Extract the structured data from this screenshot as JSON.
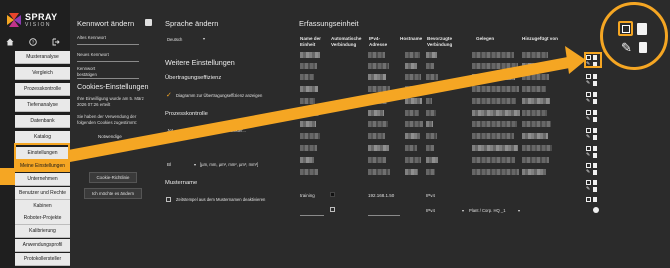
{
  "brand": {
    "name": "SPRAY",
    "sub": "VISION"
  },
  "sidebar": {
    "top_icons": [
      "home-icon",
      "help-icon",
      "logout-icon"
    ],
    "items": [
      {
        "label": "Musteranalyse"
      },
      {
        "label": "Vergleich"
      },
      {
        "label": "Prozesskontrolle"
      },
      {
        "label": "Tiefenanalyse"
      },
      {
        "label": "Datenbank"
      },
      {
        "label": "Katalog"
      },
      {
        "label": "Einstellungen"
      },
      {
        "label": "Meine Einstellungen"
      },
      {
        "label": "Unternehmen"
      },
      {
        "label": "Benutzer und Rechte"
      },
      {
        "label": "Kabinen"
      },
      {
        "label": "Roboter-Projekte"
      },
      {
        "label": "Kalibrierung"
      },
      {
        "label": "Anwendungsprofil"
      },
      {
        "label": "Protokollersteller"
      }
    ],
    "active_index": 7
  },
  "password": {
    "title": "Kennwort ändern",
    "old_label": "Altes Kennwort",
    "new_label": "Neues Kennwort",
    "confirm_label": "Kennwort bestätigen"
  },
  "cookies": {
    "title": "Cookies-Einstellungen",
    "consent_text": "Ihre Einwilligung wurde am 5. März 2026 07:26 erteilt",
    "accepted_text": "Sie haben der Verwendung der folgenden Cookies zugestimmt:",
    "items": [
      "Notwendige",
      "Analysen"
    ],
    "policy_button": "Cookie-Richtlinie",
    "change_button": "Ich möchte es ändern"
  },
  "language": {
    "title": "Sprache ändern",
    "value": "Deutsch"
  },
  "more_settings": {
    "title": "Weitere Einstellungen",
    "transfer_title": "Übertragungseffizienz",
    "transfer_option": "Diagramm zur Übertragungseffizienz anzeigen",
    "process_title": "Prozesskontrolle",
    "rows": [
      {
        "label": "Jet",
        "value": "Standardtyp für Muster..."
      },
      {
        "label": "",
        "value": ""
      },
      {
        "label": "Bl",
        "value": "[µm, mm, µm², mm², µm³, mm³]"
      }
    ],
    "pattern_title": "Mustername",
    "pattern_option": "Zeitstempel aus dem Musternamen deaktivieren"
  },
  "capture": {
    "title": "Erfassungseinheit",
    "columns": [
      "Name der Einheit",
      "Automatische Verbindung",
      "IPv4-Adresse",
      "Hostname",
      "Bevorzugte Verbindung",
      "Gelegen",
      "Hinzugefügt von"
    ],
    "rows": [
      {
        "name": "",
        "ip": "",
        "pref": ""
      },
      {
        "name": "",
        "ip": "",
        "pref": ""
      },
      {
        "name": "",
        "ip": "",
        "pref": ""
      },
      {
        "name": "",
        "ip": "",
        "pref": ""
      },
      {
        "name": "",
        "ip": "",
        "pref": ""
      },
      {
        "name": "",
        "ip": "",
        "pref": ""
      },
      {
        "name": "",
        "ip": "",
        "pref": ""
      },
      {
        "name": "",
        "ip": "",
        "pref": ""
      },
      {
        "name": "",
        "ip": "",
        "pref": ""
      },
      {
        "name": "",
        "ip": "",
        "pref": ""
      },
      {
        "name": "",
        "ip": "",
        "pref": ""
      },
      {
        "name": "training",
        "ip": "192.168.1.50",
        "pref": "IPv4"
      }
    ],
    "new_row": {
      "pref": "IPv4",
      "location": "Plant / Corp. HQ _1"
    }
  },
  "zoom_icons": [
    "download-icon",
    "clipboard-icon",
    "pencil-icon",
    "trash-icon"
  ],
  "colors": {
    "accent": "#f5a623",
    "background": "#2b2b2b",
    "sidebar": "#1f1f1f",
    "nav_item": "#e9e9e9"
  }
}
